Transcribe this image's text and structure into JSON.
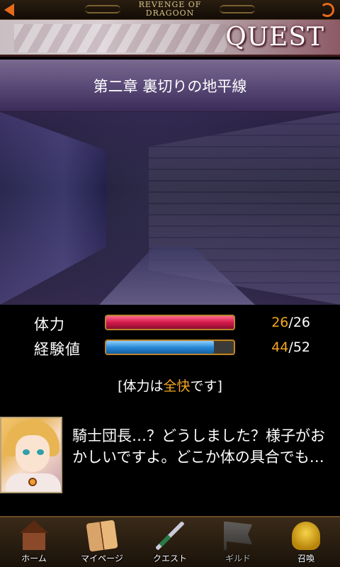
{
  "header": {
    "logo_line1": "REVENGE OF",
    "logo_line2": "DRAGOON"
  },
  "banner": {
    "title": "QUEST"
  },
  "chapter": {
    "title": "第二章 裏切りの地平線"
  },
  "stats": {
    "hp": {
      "label": "体力",
      "current": "26",
      "max": "26",
      "fraction": 1.0
    },
    "exp": {
      "label": "経験値",
      "current": "44",
      "max": "52",
      "fraction": 0.846
    },
    "separator": "/"
  },
  "status": {
    "prefix": "[体力は",
    "highlight": "全快",
    "suffix": "です]"
  },
  "dialogue": {
    "text": "騎士団長…？どうしました？様子がおかしいですよ。どこか体の具合でも…"
  },
  "nav": {
    "items": [
      {
        "label": "ホーム",
        "icon": "house-icon"
      },
      {
        "label": "マイページ",
        "icon": "book-icon"
      },
      {
        "label": "クエスト",
        "icon": "sword-icon"
      },
      {
        "label": "ギルド",
        "icon": "flag-icon"
      },
      {
        "label": "召喚",
        "icon": "summon-bell-icon"
      }
    ]
  },
  "colors": {
    "accent": "#f5a623",
    "back_arrow": "#e86a1a",
    "hp_bar": "#d41a4a",
    "exp_bar": "#2a8ad8"
  }
}
